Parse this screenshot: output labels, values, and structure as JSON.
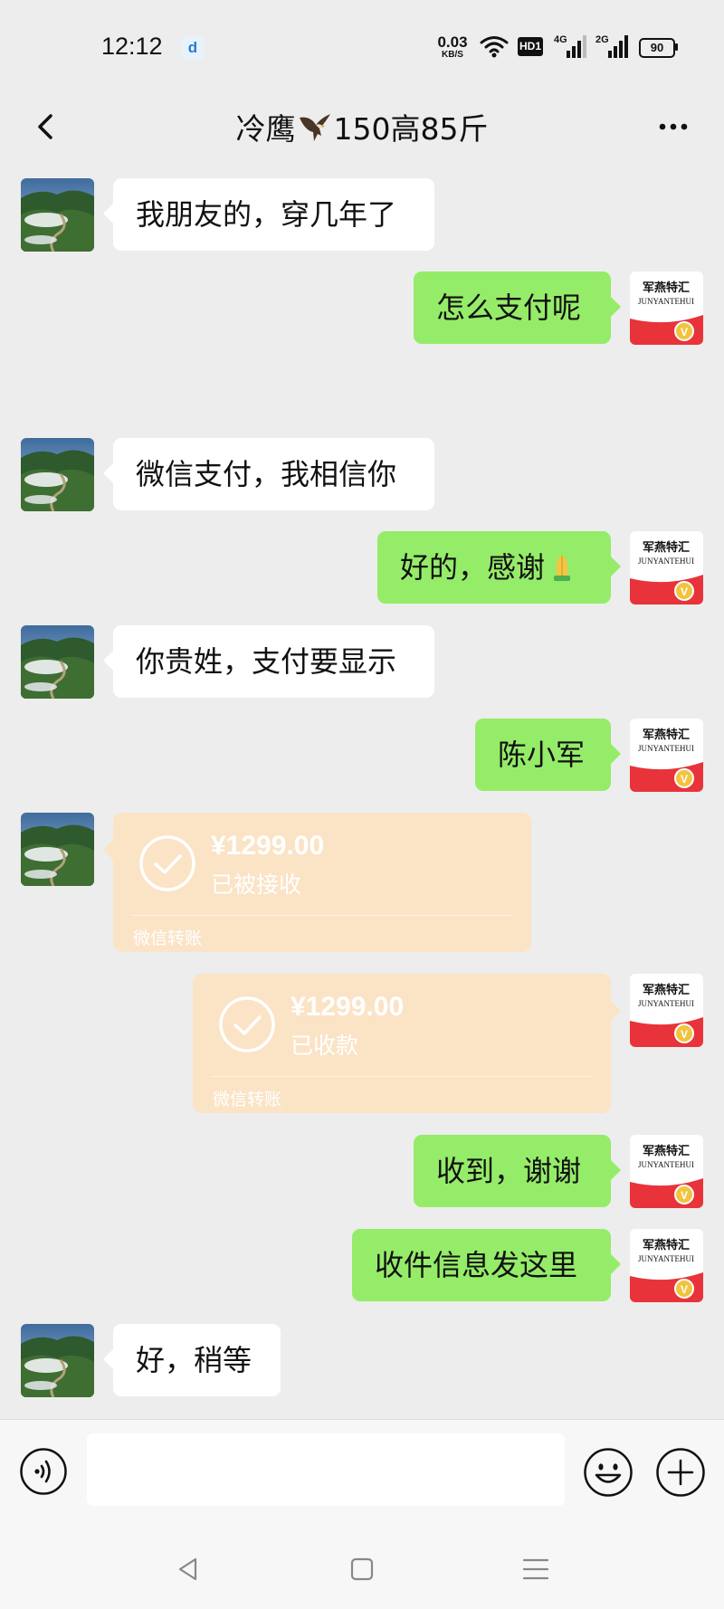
{
  "status_bar": {
    "time": "12:12",
    "app_badge": "d",
    "net_speed_value": "0.03",
    "net_speed_unit": "KB/S",
    "hd_label": "HD1",
    "sim1_label": "4G",
    "sim2_label": "2G",
    "battery": "90"
  },
  "header": {
    "title_prefix": "冷鹰",
    "title_suffix": "150高85斤",
    "title_icon": "eagle-icon"
  },
  "chat": {
    "friend_avatar": "mountain-landscape-avatar",
    "my_avatar": "junyantehui-logo-avatar",
    "my_avatar_line1": "军燕特汇",
    "my_avatar_line2": "JUNYANTEHUI",
    "my_avatar_badge": "V",
    "messages": [
      {
        "side": "in",
        "text": "我朋友的，穿几年了"
      },
      {
        "side": "out",
        "text": "怎么支付呢"
      },
      {
        "side": "in",
        "text": "微信支付，我相信你"
      },
      {
        "side": "out",
        "text": "好的，感谢",
        "emoji": "folded-hands-icon"
      },
      {
        "side": "in",
        "text": "你贵姓，支付要显示"
      },
      {
        "side": "out",
        "text": "陈小军"
      },
      {
        "side": "in",
        "type": "transfer",
        "amount": "¥1299.00",
        "status": "已被接收",
        "label": "微信转账"
      },
      {
        "side": "out",
        "type": "transfer",
        "amount": "¥1299.00",
        "status": "已收款",
        "label": "微信转账"
      },
      {
        "side": "out",
        "text": "收到，谢谢"
      },
      {
        "side": "out",
        "text": "收件信息发这里"
      },
      {
        "side": "in",
        "text": "好，稍等"
      }
    ]
  },
  "input_bar": {
    "voice_icon": "voice-icon",
    "text_value": "",
    "emoji_icon": "emoji-icon",
    "plus_icon": "plus-icon"
  },
  "nav_bar": {
    "back_icon": "nav-back-icon",
    "home_icon": "nav-home-icon",
    "menu_icon": "nav-menu-icon"
  },
  "colors": {
    "background": "#ededed",
    "outgoing_bubble": "#95ec69",
    "incoming_bubble": "#ffffff",
    "transfer_bubble": "#fbe3c6"
  }
}
